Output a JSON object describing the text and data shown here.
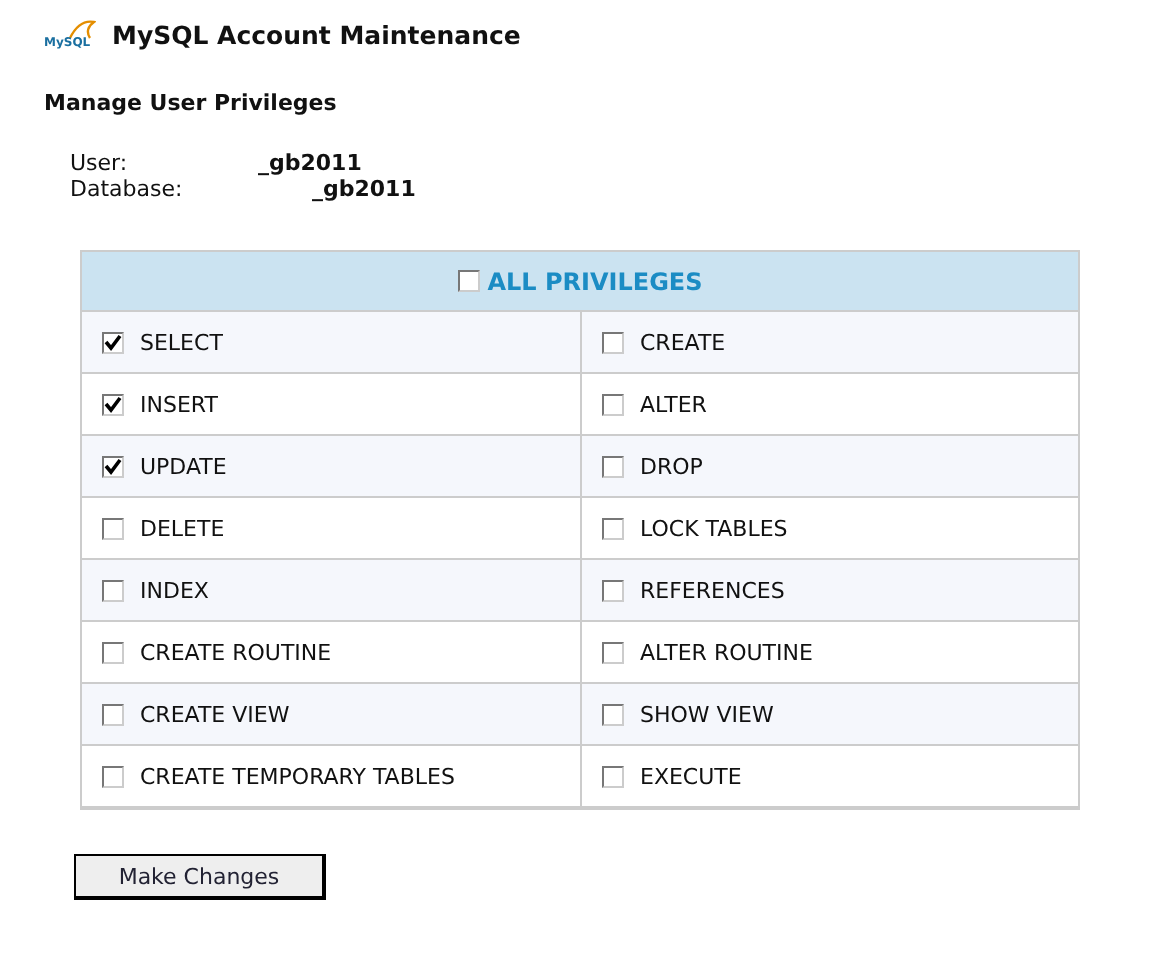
{
  "header": {
    "logo": "MySQL",
    "title": "MySQL Account Maintenance"
  },
  "subtitle": "Manage User Privileges",
  "info": [
    {
      "label": "User:",
      "value": "_gb2011"
    },
    {
      "label": "Database:",
      "value": "_gb2011"
    }
  ],
  "all_privileges": {
    "label": "ALL PRIVILEGES",
    "checked": false
  },
  "privileges": [
    {
      "label": "SELECT",
      "checked": true
    },
    {
      "label": "CREATE",
      "checked": false
    },
    {
      "label": "INSERT",
      "checked": true
    },
    {
      "label": "ALTER",
      "checked": false
    },
    {
      "label": "UPDATE",
      "checked": true
    },
    {
      "label": "DROP",
      "checked": false
    },
    {
      "label": "DELETE",
      "checked": false
    },
    {
      "label": "LOCK TABLES",
      "checked": false
    },
    {
      "label": "INDEX",
      "checked": false
    },
    {
      "label": "REFERENCES",
      "checked": false
    },
    {
      "label": "CREATE ROUTINE",
      "checked": false
    },
    {
      "label": "ALTER ROUTINE",
      "checked": false
    },
    {
      "label": "CREATE VIEW",
      "checked": false
    },
    {
      "label": "SHOW VIEW",
      "checked": false
    },
    {
      "label": "CREATE TEMPORARY TABLES",
      "checked": false
    },
    {
      "label": "EXECUTE",
      "checked": false
    }
  ],
  "button": "Make Changes"
}
